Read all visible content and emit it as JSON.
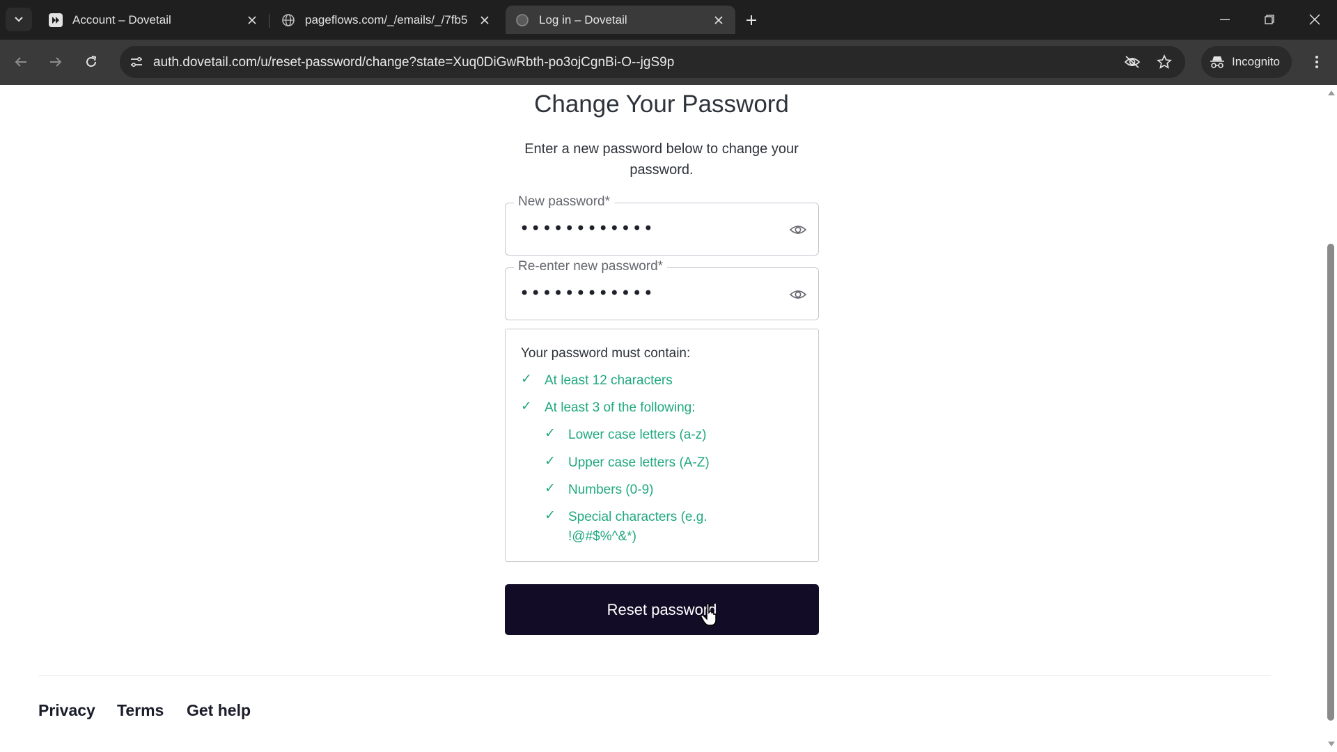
{
  "browser": {
    "tabs": [
      {
        "title": "Account – Dovetail",
        "favicon": "dovetail-logo-icon",
        "active": false
      },
      {
        "title": "pageflows.com/_/emails/_/7fb5",
        "favicon": "globe-icon",
        "active": false
      },
      {
        "title": "Log in – Dovetail",
        "favicon": "globe-icon",
        "active": true
      }
    ],
    "url": "auth.dovetail.com/u/reset-password/change?state=Xuq0DiGwRbth-po3ojCgnBi-O--jgS9p",
    "incognito_label": "Incognito"
  },
  "page": {
    "title": "Change Your Password",
    "subtitle": "Enter a new password below to change your password.",
    "new_password": {
      "label": "New password*",
      "value": "••••••••••••"
    },
    "reenter_password": {
      "label": "Re-enter new password*",
      "value": "••••••••••••"
    },
    "requirements": {
      "title": "Your password must contain:",
      "check_glyph": "✓",
      "items": [
        {
          "text": "At least 12 characters",
          "met": true
        },
        {
          "text": "At least 3 of the following:",
          "met": true
        },
        {
          "text": "Lower case letters (a-z)",
          "met": true
        },
        {
          "text": "Upper case letters (A-Z)",
          "met": true
        },
        {
          "text": "Numbers (0-9)",
          "met": true
        },
        {
          "text": "Special characters (e.g. !@#$%^&*)",
          "met": true
        }
      ]
    },
    "reset_button": "Reset password",
    "footer": {
      "privacy": "Privacy",
      "terms": "Terms",
      "help": "Get help"
    }
  },
  "colors": {
    "success_green": "#1fa87e",
    "button_bg": "#130c26",
    "chrome_dark": "#1f1f1f",
    "toolbar": "#3a3a3a"
  }
}
